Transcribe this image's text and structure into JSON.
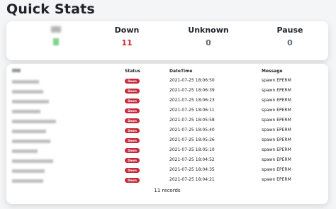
{
  "page": {
    "title": "Quick Stats"
  },
  "stats": {
    "down": {
      "label": "Down",
      "value": "11",
      "color": "#c52b3a"
    },
    "unknown": {
      "label": "Unknown",
      "value": "0"
    },
    "pause": {
      "label": "Pause",
      "value": "0"
    }
  },
  "table": {
    "columns": {
      "status": "Status",
      "datetime": "DateTime",
      "message": "Message"
    },
    "rows": [
      {
        "status": "Down",
        "datetime": "2021-07-25 18:06:50",
        "message": "spawn EPERM"
      },
      {
        "status": "Down",
        "datetime": "2021-07-25 18:06:39",
        "message": "spawn EPERM"
      },
      {
        "status": "Down",
        "datetime": "2021-07-25 18:06:23",
        "message": "spawn EPERM"
      },
      {
        "status": "Down",
        "datetime": "2021-07-25 18:06:11",
        "message": "spawn EPERM"
      },
      {
        "status": "Down",
        "datetime": "2021-07-25 18:05:58",
        "message": "spawn EPERM"
      },
      {
        "status": "Down",
        "datetime": "2021-07-25 18:05:40",
        "message": "spawn EPERM"
      },
      {
        "status": "Down",
        "datetime": "2021-07-25 18:05:26",
        "message": "spawn EPERM"
      },
      {
        "status": "Down",
        "datetime": "2021-07-25 18:05:10",
        "message": "spawn EPERM"
      },
      {
        "status": "Down",
        "datetime": "2021-07-25 18:04:52",
        "message": "spawn EPERM"
      },
      {
        "status": "Down",
        "datetime": "2021-07-25 18:04:35",
        "message": "spawn EPERM"
      },
      {
        "status": "Down",
        "datetime": "2021-07-25 18:04:21",
        "message": "spawn EPERM"
      }
    ],
    "records_text": "11 records"
  }
}
